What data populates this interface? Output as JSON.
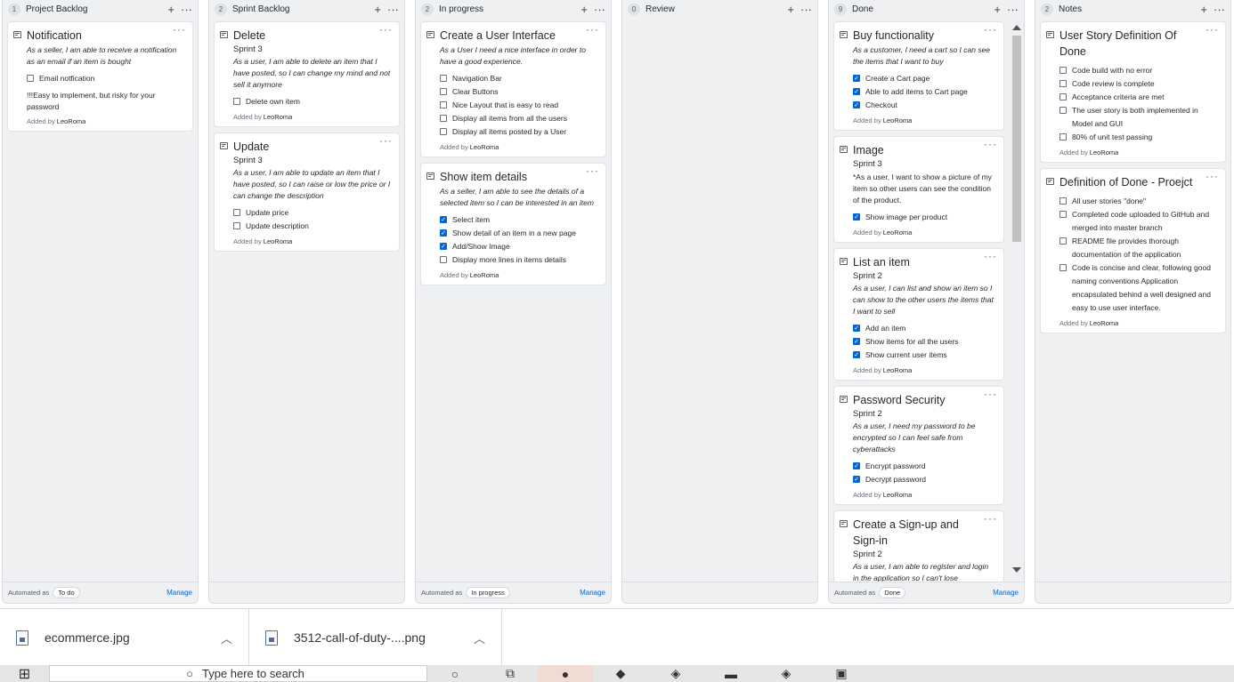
{
  "columns": [
    {
      "count": "1",
      "name": "Project Backlog",
      "automated": "To do",
      "manage": "Manage",
      "cards": [
        {
          "title": "Notification",
          "sprint": "",
          "desc": "As a seller, I am able to receive a notification as an email if an item is bought",
          "checks": [
            {
              "label": "Email notfication",
              "checked": false
            }
          ],
          "note": "!!!Easy to implement, but risky for your password",
          "added_by": "LeoRoma"
        }
      ]
    },
    {
      "count": "2",
      "name": "Sprint Backlog",
      "automated": "",
      "manage": "",
      "cards": [
        {
          "title": "Delete",
          "sprint": "Sprint 3",
          "desc": "As a user, I am able to delete an item that I have posted, so I can change my mind and not sell it anymore",
          "checks": [
            {
              "label": "Delete own item",
              "checked": false
            }
          ],
          "note": "",
          "added_by": "LeoRoma"
        },
        {
          "title": "Update",
          "sprint": "Sprint 3",
          "desc": "As a user, I am able to update an item that I have posted, so I can raise or low the price or I can change the description",
          "checks": [
            {
              "label": "Update price",
              "checked": false
            },
            {
              "label": "Update description",
              "checked": false
            }
          ],
          "note": "",
          "added_by": "LeoRoma"
        }
      ]
    },
    {
      "count": "2",
      "name": "In progress",
      "automated": "In progress",
      "manage": "Manage",
      "cards": [
        {
          "title": "Create a User Interface",
          "sprint": "",
          "desc": "As a User I need a nice interface in order to have a good experience.",
          "checks": [
            {
              "label": "Navigation Bar",
              "checked": false
            },
            {
              "label": "Clear Buttons",
              "checked": false
            },
            {
              "label": "Nice Layout that is easy to read",
              "checked": false
            },
            {
              "label": "Display all items from all the users",
              "checked": false
            },
            {
              "label": "Display all items posted by a User",
              "checked": false
            }
          ],
          "note": "",
          "added_by": "LeoRoma"
        },
        {
          "title": "Show item details",
          "sprint": "",
          "desc": "As a seller, I am able to see the details of a selected item so I can be interested in an item",
          "checks": [
            {
              "label": "Select item",
              "checked": true
            },
            {
              "label": "Show detail of an item in a new page",
              "checked": true
            },
            {
              "label": "Add/Show Image",
              "checked": true
            },
            {
              "label": "Display more lines in items details",
              "checked": false
            }
          ],
          "note": "",
          "added_by": "LeoRoma"
        }
      ]
    },
    {
      "count": "0",
      "name": "Review",
      "automated": "",
      "manage": "",
      "cards": []
    },
    {
      "count": "9",
      "name": "Done",
      "automated": "Done",
      "manage": "Manage",
      "cards": [
        {
          "title": "Buy functionality",
          "sprint": "",
          "desc": "As a customer, I need a cart so I can see the items that I want to buy",
          "checks": [
            {
              "label": "Create a Cart page",
              "checked": true
            },
            {
              "label": "Able to add items to Cart page",
              "checked": true
            },
            {
              "label": "Checkout",
              "checked": true
            }
          ],
          "note": "",
          "added_by": "LeoRoma"
        },
        {
          "title": "Image",
          "sprint": "Sprint 3",
          "desc": "",
          "plain": "*As a user, I want to show a picture of my item so other users can see the condition of the product.",
          "checks": [
            {
              "label": "Show image per product",
              "checked": true
            }
          ],
          "note": "",
          "added_by": "LeoRoma"
        },
        {
          "title": "List an item",
          "sprint": "Sprint 2",
          "desc": "As a user, I can list and show an item so I can show to the other users the items that I want to sell",
          "checks": [
            {
              "label": "Add an item",
              "checked": true
            },
            {
              "label": "Show items for all the users",
              "checked": true
            },
            {
              "label": "Show current user items",
              "checked": true
            }
          ],
          "note": "",
          "added_by": "LeoRoma"
        },
        {
          "title": "Password Security",
          "sprint": "Sprint 2",
          "desc": "As a user, I need my password to be encrypted so I can feel safe from cyberattacks",
          "checks": [
            {
              "label": "Encrypt password",
              "checked": true
            },
            {
              "label": "Decrypt password",
              "checked": true
            }
          ],
          "note": "",
          "added_by": "LeoRoma"
        },
        {
          "title": "Create a Sign-up and Sign-in",
          "sprint": "Sprint 2",
          "desc": "As a user, I am able to register and login in the application so I can't lose",
          "checks": [],
          "note": "",
          "added_by": ""
        }
      ]
    },
    {
      "count": "2",
      "name": "Notes",
      "automated": "",
      "manage": "",
      "cards": [
        {
          "title": "User Story Definition Of Done",
          "sprint": "",
          "desc": "",
          "checks": [
            {
              "label": "Code build with no error",
              "checked": false
            },
            {
              "label": "Code review is complete",
              "checked": false
            },
            {
              "label": "Acceptance criteria are met",
              "checked": false
            },
            {
              "label": "The user story is both implemented in Model and GUI",
              "checked": false
            },
            {
              "label": "80% of unit test passing",
              "checked": false
            }
          ],
          "note": "",
          "added_by": "LeoRoma"
        },
        {
          "title": "Definition of Done - Proejct",
          "sprint": "",
          "desc": "",
          "checks": [
            {
              "label": "All user stories \"done\"",
              "checked": false
            },
            {
              "label": "Completed code uploaded to GitHub and merged into master branch",
              "checked": false
            },
            {
              "label": "README file provides thorough documentation of the application",
              "checked": false
            },
            {
              "label": "Code is concise and clear, following good naming conventions Application encapsulated behind a well designed and easy to use user interface.",
              "checked": false
            }
          ],
          "note": "",
          "added_by": "LeoRoma"
        }
      ]
    }
  ],
  "labels": {
    "added_prefix": "Added by",
    "automated_prefix": "Automated as",
    "plus": "+",
    "menu": "···"
  },
  "downloads": [
    {
      "name": "ecommerce.jpg"
    },
    {
      "name": "3512-call-of-duty-....png"
    }
  ],
  "taskbar": {
    "search_placeholder": "Type here to search"
  }
}
